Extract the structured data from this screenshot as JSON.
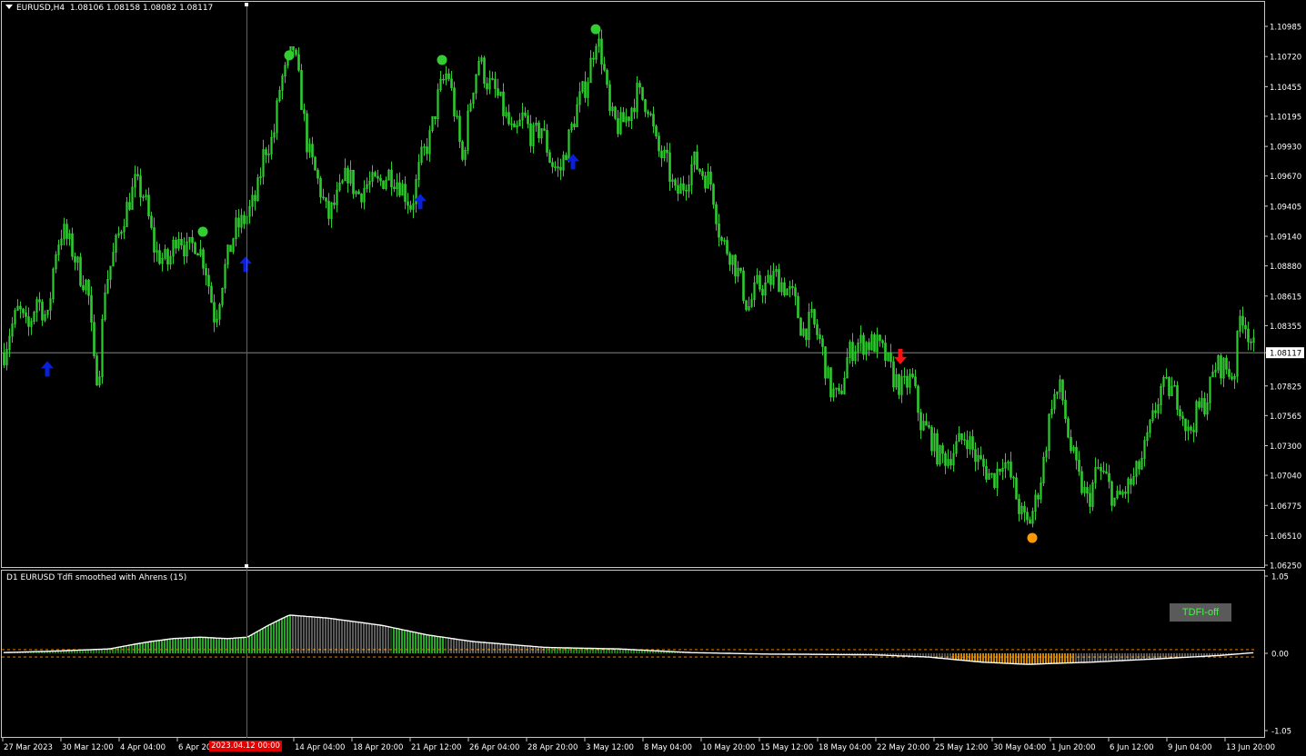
{
  "header": {
    "title": "EURUSD,H4  1.08106 1.08158 1.08082 1.08117"
  },
  "indicator": {
    "title": "D1 EURUSD Tdfi smoothed with Ahrens (15)",
    "button_label": "TDFI-off",
    "axis_labels": [
      "1.05",
      "0.00",
      "-1.05"
    ]
  },
  "crosshair": {
    "time_label": "2023.04.12 00:00"
  },
  "colors": {
    "background": "#000000",
    "candle": "#2ecc2e",
    "arrow_up": "#0a1fd8",
    "arrow_down": "#ff1010",
    "dot_top": "#32cd32",
    "dot_bottom": "#ff9900",
    "crosshair": "#ff2020",
    "histogram_positive": "#32cd32",
    "histogram_negative": "#ffa500",
    "tdfi_line": "#ffffff",
    "level_line": "#ff9900"
  },
  "chart_data": [
    {
      "type": "candlestick",
      "symbol": "EURUSD",
      "timeframe": "H4",
      "current_price": "1.08117",
      "ylim": [
        1.0625,
        1.1105
      ],
      "y_ticks": [
        "1.10985",
        "1.10720",
        "1.10455",
        "1.10195",
        "1.09930",
        "1.09670",
        "1.09405",
        "1.09140",
        "1.08880",
        "1.08615",
        "1.08355",
        "1.08117",
        "1.07825",
        "1.07565",
        "1.07300",
        "1.07040",
        "1.06775",
        "1.06510",
        "1.06250"
      ],
      "x_ticks": [
        "27 Mar 2023",
        "30 Mar 12:00",
        "4 Apr 04:00",
        "6 Apr 20:00",
        "14 Apr 04:00",
        "18 Apr 20:00",
        "21 Apr 12:00",
        "26 Apr 04:00",
        "28 Apr 20:00",
        "3 May 12:00",
        "8 May 04:00",
        "10 May 20:00",
        "15 May 12:00",
        "18 May 04:00",
        "22 May 20:00",
        "25 May 12:00",
        "30 May 04:00",
        "1 Jun 20:00",
        "6 Jun 12:00",
        "9 Jun 04:00",
        "13 Jun 20:00"
      ],
      "close_path": [
        [
          0,
          1.08
        ],
        [
          10,
          1.083
        ],
        [
          20,
          1.085
        ],
        [
          30,
          1.083
        ],
        [
          40,
          1.086
        ],
        [
          52,
          1.084
        ],
        [
          60,
          1.09
        ],
        [
          68,
          1.092
        ],
        [
          80,
          1.09
        ],
        [
          88,
          1.088
        ],
        [
          96,
          1.087
        ],
        [
          103,
          1.08
        ],
        [
          108,
          1.079
        ],
        [
          115,
          1.087
        ],
        [
          125,
          1.09
        ],
        [
          135,
          1.093
        ],
        [
          148,
          1.096
        ],
        [
          158,
          1.095
        ],
        [
          170,
          1.09
        ],
        [
          185,
          1.089
        ],
        [
          195,
          1.092
        ],
        [
          205,
          1.09
        ],
        [
          215,
          1.091
        ],
        [
          225,
          1.089
        ],
        [
          236,
          1.084
        ],
        [
          245,
          1.088
        ],
        [
          258,
          1.092
        ],
        [
          270,
          1.093
        ],
        [
          282,
          1.095
        ],
        [
          290,
          1.099
        ],
        [
          300,
          1.1
        ],
        [
          308,
          1.105
        ],
        [
          315,
          1.106
        ],
        [
          322,
          1.108
        ],
        [
          330,
          1.104
        ],
        [
          338,
          1.099
        ],
        [
          350,
          1.096
        ],
        [
          360,
          1.093
        ],
        [
          372,
          1.095
        ],
        [
          382,
          1.097
        ],
        [
          392,
          1.095
        ],
        [
          404,
          1.096
        ],
        [
          416,
          1.096
        ],
        [
          428,
          1.097
        ],
        [
          440,
          1.096
        ],
        [
          452,
          1.094
        ],
        [
          462,
          1.098
        ],
        [
          472,
          1.1
        ],
        [
          482,
          1.104
        ],
        [
          492,
          1.106
        ],
        [
          500,
          1.102
        ],
        [
          508,
          1.098
        ],
        [
          518,
          1.104
        ],
        [
          526,
          1.107
        ],
        [
          535,
          1.105
        ],
        [
          545,
          1.104
        ],
        [
          555,
          1.102
        ],
        [
          565,
          1.1
        ],
        [
          575,
          1.102
        ],
        [
          585,
          1.1
        ],
        [
          595,
          1.101
        ],
        [
          605,
          1.098
        ],
        [
          615,
          1.097
        ],
        [
          625,
          1.1
        ],
        [
          635,
          1.103
        ],
        [
          645,
          1.105
        ],
        [
          655,
          1.109
        ],
        [
          662,
          1.107
        ],
        [
          670,
          1.102
        ],
        [
          680,
          1.101
        ],
        [
          690,
          1.102
        ],
        [
          700,
          1.104
        ],
        [
          712,
          1.103
        ],
        [
          722,
          1.099
        ],
        [
          732,
          1.098
        ],
        [
          742,
          1.095
        ],
        [
          752,
          1.096
        ],
        [
          762,
          1.098
        ],
        [
          772,
          1.097
        ],
        [
          782,
          1.096
        ],
        [
          792,
          1.091
        ],
        [
          802,
          1.09
        ],
        [
          812,
          1.088
        ],
        [
          822,
          1.085
        ],
        [
          832,
          1.087
        ],
        [
          842,
          1.087
        ],
        [
          852,
          1.088
        ],
        [
          862,
          1.087
        ],
        [
          872,
          1.086
        ],
        [
          882,
          1.083
        ],
        [
          892,
          1.084
        ],
        [
          902,
          1.082
        ],
        [
          912,
          1.078
        ],
        [
          922,
          1.077
        ],
        [
          932,
          1.081
        ],
        [
          942,
          1.082
        ],
        [
          952,
          1.082
        ],
        [
          962,
          1.082
        ],
        [
          972,
          1.081
        ],
        [
          982,
          1.079
        ],
        [
          992,
          1.078
        ],
        [
          1002,
          1.079
        ],
        [
          1012,
          1.075
        ],
        [
          1022,
          1.074
        ],
        [
          1032,
          1.072
        ],
        [
          1042,
          1.072
        ],
        [
          1052,
          1.073
        ],
        [
          1062,
          1.074
        ],
        [
          1072,
          1.072
        ],
        [
          1082,
          1.071
        ],
        [
          1092,
          1.07
        ],
        [
          1102,
          1.072
        ],
        [
          1112,
          1.07
        ],
        [
          1122,
          1.067
        ],
        [
          1130,
          1.066
        ],
        [
          1138,
          1.068
        ],
        [
          1146,
          1.071
        ],
        [
          1156,
          1.077
        ],
        [
          1166,
          1.078
        ],
        [
          1176,
          1.073
        ],
        [
          1186,
          1.07
        ],
        [
          1196,
          1.068
        ],
        [
          1206,
          1.071
        ],
        [
          1216,
          1.07
        ],
        [
          1226,
          1.068
        ],
        [
          1236,
          1.069
        ],
        [
          1246,
          1.07
        ],
        [
          1256,
          1.072
        ],
        [
          1266,
          1.075
        ],
        [
          1276,
          1.078
        ],
        [
          1286,
          1.078
        ],
        [
          1296,
          1.077
        ],
        [
          1306,
          1.074
        ],
        [
          1316,
          1.076
        ],
        [
          1326,
          1.077
        ],
        [
          1336,
          1.08
        ],
        [
          1346,
          1.08
        ],
        [
          1356,
          1.079
        ],
        [
          1364,
          1.085
        ],
        [
          1372,
          1.083
        ],
        [
          1380,
          1.081
        ]
      ],
      "markers": [
        {
          "kind": "arrow_up",
          "x_index": 52,
          "price": 1.0798
        },
        {
          "kind": "arrow_up",
          "x_index": 270,
          "price": 1.089
        },
        {
          "kind": "arrow_up",
          "x_index": 462,
          "price": 1.0945
        },
        {
          "kind": "arrow_up",
          "x_index": 630,
          "price": 1.098
        },
        {
          "kind": "arrow_down",
          "x_index": 990,
          "price": 1.0808
        },
        {
          "kind": "dot_top",
          "x_index": 223,
          "price": 1.0918
        },
        {
          "kind": "dot_top",
          "x_index": 318,
          "price": 1.1073
        },
        {
          "kind": "dot_top",
          "x_index": 486,
          "price": 1.1069
        },
        {
          "kind": "dot_top",
          "x_index": 655,
          "price": 1.1096
        },
        {
          "kind": "dot_bottom",
          "x_index": 1135,
          "price": 1.0649
        }
      ]
    },
    {
      "type": "histogram",
      "name": "Tdfi smoothed with Ahrens (15)",
      "ylim": [
        -1.05,
        1.05
      ],
      "levels": [
        0.05,
        -0.05
      ],
      "profile": [
        [
          4,
          0.01
        ],
        [
          60,
          0.03
        ],
        [
          120,
          0.06
        ],
        [
          160,
          0.15
        ],
        [
          190,
          0.2
        ],
        [
          220,
          0.22
        ],
        [
          250,
          0.2
        ],
        [
          272,
          0.22
        ],
        [
          295,
          0.38
        ],
        [
          318,
          0.52
        ],
        [
          360,
          0.48
        ],
        [
          420,
          0.38
        ],
        [
          470,
          0.25
        ],
        [
          520,
          0.16
        ],
        [
          600,
          0.08
        ],
        [
          680,
          0.06
        ],
        [
          760,
          0.01
        ],
        [
          840,
          -0.01
        ],
        [
          960,
          -0.02
        ],
        [
          1020,
          -0.05
        ],
        [
          1080,
          -0.12
        ],
        [
          1130,
          -0.15
        ],
        [
          1200,
          -0.12
        ],
        [
          1280,
          -0.07
        ],
        [
          1340,
          -0.03
        ],
        [
          1380,
          0.01
        ]
      ]
    }
  ]
}
